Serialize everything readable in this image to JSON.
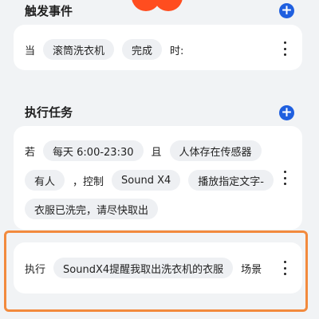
{
  "trigger_section": {
    "title": "触发事件",
    "condition": {
      "when": "当",
      "device": "滚筒洗衣机",
      "state": "完成",
      "suffix": "时:"
    }
  },
  "task_section": {
    "title": "执行任务",
    "rule": {
      "if_word": "若",
      "schedule": "每天 6:00-23:30",
      "and_word": "且",
      "sensor": "人体存在传感器",
      "sensor_state": "有人",
      "control_word": "，控制",
      "target_device": "Sound X4",
      "action": "播放指定文字-",
      "action_text": "衣服已洗完，请尽快取出"
    },
    "scene": {
      "execute_word": "执行",
      "scene_name": "SoundX4提醒我取出洗衣机的衣服",
      "scene_word": "场景"
    }
  },
  "colors": {
    "accent_blue": "#1f5fdf",
    "highlight_orange": "#f28a3d",
    "brand_red": "#ff4d1f"
  }
}
